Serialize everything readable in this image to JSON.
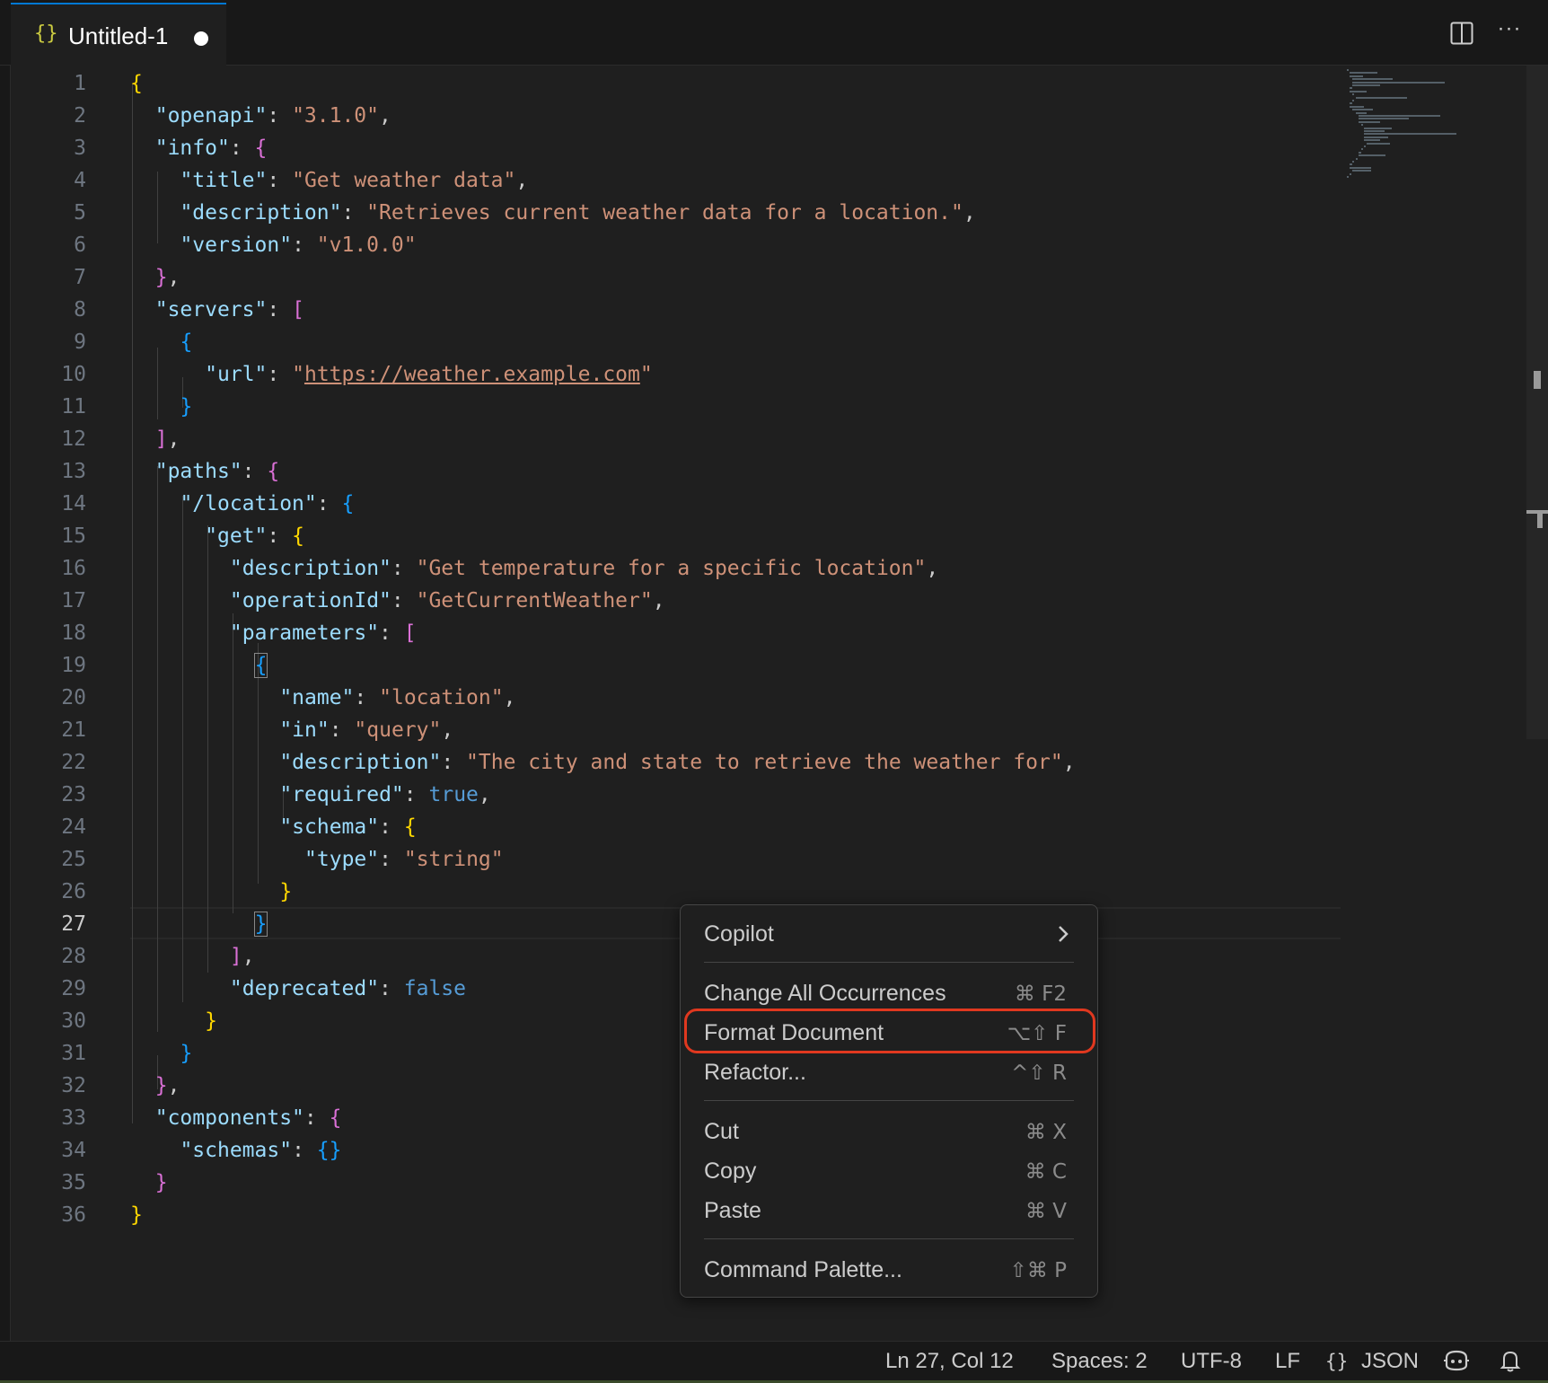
{
  "tab": {
    "title": "Untitled-1",
    "icon": "{}"
  },
  "editor": {
    "active_line": 27,
    "lines": [
      {
        "n": "1"
      },
      {
        "n": "2"
      },
      {
        "n": "3"
      },
      {
        "n": "4"
      },
      {
        "n": "5"
      },
      {
        "n": "6"
      },
      {
        "n": "7"
      },
      {
        "n": "8"
      },
      {
        "n": "9"
      },
      {
        "n": "10"
      },
      {
        "n": "11"
      },
      {
        "n": "12"
      },
      {
        "n": "13"
      },
      {
        "n": "14"
      },
      {
        "n": "15"
      },
      {
        "n": "16"
      },
      {
        "n": "17"
      },
      {
        "n": "18"
      },
      {
        "n": "19"
      },
      {
        "n": "20"
      },
      {
        "n": "21"
      },
      {
        "n": "22"
      },
      {
        "n": "23"
      },
      {
        "n": "24"
      },
      {
        "n": "25"
      },
      {
        "n": "26"
      },
      {
        "n": "27"
      },
      {
        "n": "28"
      },
      {
        "n": "29"
      },
      {
        "n": "30"
      },
      {
        "n": "31"
      },
      {
        "n": "32"
      },
      {
        "n": "33"
      },
      {
        "n": "34"
      },
      {
        "n": "35"
      },
      {
        "n": "36"
      }
    ],
    "code": [
      "{",
      "  \"openapi\": \"3.1.0\",",
      "  \"info\": {",
      "    \"title\": \"Get weather data\",",
      "    \"description\": \"Retrieves current weather data for a location.\",",
      "    \"version\": \"v1.0.0\"",
      "  },",
      "  \"servers\": [",
      "    {",
      "      \"url\": \"https://weather.example.com\"",
      "    }",
      "  ],",
      "  \"paths\": {",
      "    \"/location\": {",
      "      \"get\": {",
      "        \"description\": \"Get temperature for a specific location\",",
      "        \"operationId\": \"GetCurrentWeather\",",
      "        \"parameters\": [",
      "          {",
      "            \"name\": \"location\",",
      "            \"in\": \"query\",",
      "            \"description\": \"The city and state to retrieve the weather for\",",
      "            \"required\": true,",
      "            \"schema\": {",
      "              \"type\": \"string\"",
      "            }",
      "          }",
      "        ],",
      "        \"deprecated\": false",
      "      }",
      "    }",
      "  },",
      "  \"components\": {",
      "    \"schemas\": {}",
      "  }",
      "}"
    ]
  },
  "context_menu": {
    "items": [
      {
        "label": "Copilot",
        "shortcut": "",
        "submenu": true
      },
      {
        "label": "Change All Occurrences",
        "shortcut": "⌘ F2"
      },
      {
        "label": "Format Document",
        "shortcut": "⌥⇧ F",
        "highlighted": true
      },
      {
        "label": "Refactor...",
        "shortcut": "^⇧ R"
      },
      {
        "label": "Cut",
        "shortcut": "⌘ X"
      },
      {
        "label": "Copy",
        "shortcut": "⌘ C"
      },
      {
        "label": "Paste",
        "shortcut": "⌘ V"
      },
      {
        "label": "Command Palette...",
        "shortcut": "⇧⌘ P"
      }
    ]
  },
  "status_bar": {
    "position": "Ln 27, Col 12",
    "spaces": "Spaces: 2",
    "encoding": "UTF-8",
    "eol": "LF",
    "language_icon": "{}",
    "language": "JSON"
  },
  "colors": {
    "editor_bg": "#1f1f1f",
    "key": "#9cdcfe",
    "string": "#ce9178",
    "bracket_gold": "#ffd700",
    "bracket_orchid": "#da70d6",
    "bracket_blue": "#179fff",
    "keyword": "#569cd6",
    "highlight_ring": "#e0381f",
    "accent": "#0078d4"
  }
}
